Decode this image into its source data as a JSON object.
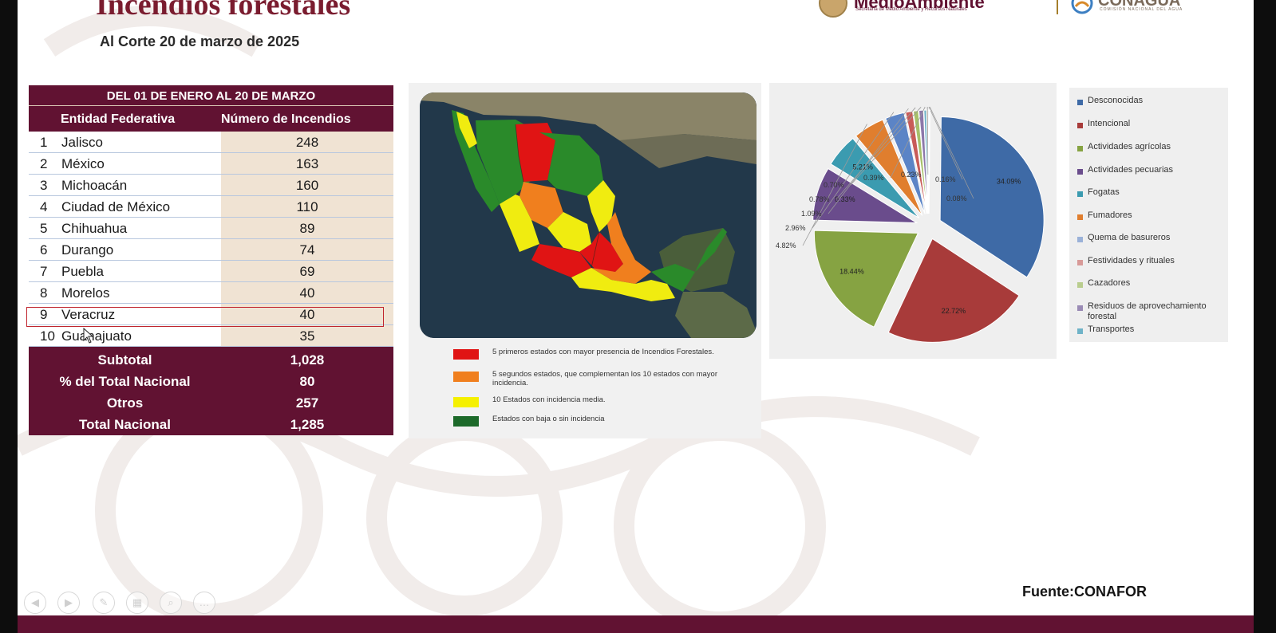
{
  "slide": {
    "title": "Incendios forestales",
    "subtitle": "Al Corte 20 de marzo de 2025",
    "source": "Fuente:CONAFOR"
  },
  "logos": {
    "medio_ambiente": "MedioAmbiente",
    "medio_ambiente_sub": "Secretaría de Medio Ambiente y Recursos Naturales",
    "conagua": "CONAGUA",
    "conagua_sub": "COMISIÓN NACIONAL DEL AGUA"
  },
  "table": {
    "period_header": "DEL 01 DE ENERO AL 20 DE MARZO",
    "col_entity": "Entidad Federativa",
    "col_count": "Número de Incendios",
    "rows": [
      {
        "rank": "1",
        "name": "Jalisco",
        "value": "248"
      },
      {
        "rank": "2",
        "name": "México",
        "value": "163"
      },
      {
        "rank": "3",
        "name": "Michoacán",
        "value": "160"
      },
      {
        "rank": "4",
        "name": "Ciudad de México",
        "value": "110"
      },
      {
        "rank": "5",
        "name": "Chihuahua",
        "value": "89"
      },
      {
        "rank": "6",
        "name": "Durango",
        "value": "74"
      },
      {
        "rank": "7",
        "name": "Puebla",
        "value": "69"
      },
      {
        "rank": "8",
        "name": "Morelos",
        "value": "40"
      },
      {
        "rank": "9",
        "name": "Veracruz",
        "value": "40"
      },
      {
        "rank": "10",
        "name": "Guanajuato",
        "value": "35"
      }
    ],
    "footer": [
      {
        "label": "Subtotal",
        "value": "1,028"
      },
      {
        "label": "% del Total Nacional",
        "value": "80"
      },
      {
        "label": "Otros",
        "value": "257"
      },
      {
        "label": "Total Nacional",
        "value": "1,285"
      }
    ]
  },
  "map_legend": [
    {
      "color": "#e01414",
      "text": "5 primeros estados con mayor presencia de Incendios Forestales."
    },
    {
      "color": "#f07f1e",
      "text": "5 segundos estados, que complementan los 10 estados con mayor incidencia."
    },
    {
      "color": "#f5f000",
      "text": "10 Estados con incidencia media."
    },
    {
      "color": "#1d6a2a",
      "text": "Estados con baja o sin incidencia"
    }
  ],
  "chart_data": {
    "type": "pie",
    "title": "",
    "categories": [
      "Desconocidas",
      "Intencional",
      "Actividades agrícolas",
      "Actividades pecuarias",
      "Fogatas",
      "Fumadores",
      "Quema de basureros",
      "Festividades y rituales",
      "Cazadores",
      "Residuos de aprovechamiento forestal",
      "Transportes"
    ],
    "values": [
      34.09,
      22.72,
      18.44,
      8.33,
      5.21,
      4.82,
      2.96,
      1.09,
      0.78,
      0.7,
      0.39,
      0.23,
      0.16,
      0.08
    ],
    "value_labels": [
      "34.09%",
      "22.72%",
      "18.44%",
      "8.33%",
      "5.21%",
      "4.82%",
      "2.96%",
      "1.09%",
      "0.78%",
      "0.70%",
      "0.39%",
      "0.23%",
      "0.16%",
      "0.08%"
    ],
    "colors": [
      "#3e6aa6",
      "#a83b3a",
      "#86a342",
      "#6a4c8c",
      "#3b9bb0",
      "#e07e2e",
      "#5b84c6",
      "#c85b58",
      "#a6c06a",
      "#8c78aa",
      "#6fb3c8",
      "#f0a760",
      "#9ab1d8",
      "#d89a98"
    ],
    "legend_position": "right"
  },
  "nav_buttons": [
    {
      "name": "prev-slide-button",
      "glyph": "◀"
    },
    {
      "name": "next-slide-button",
      "glyph": "▶"
    },
    {
      "name": "pen-tool-button",
      "glyph": "✎"
    },
    {
      "name": "slides-overview-button",
      "glyph": "▦"
    },
    {
      "name": "zoom-button",
      "glyph": "⌕"
    },
    {
      "name": "more-options-button",
      "glyph": "…"
    }
  ]
}
